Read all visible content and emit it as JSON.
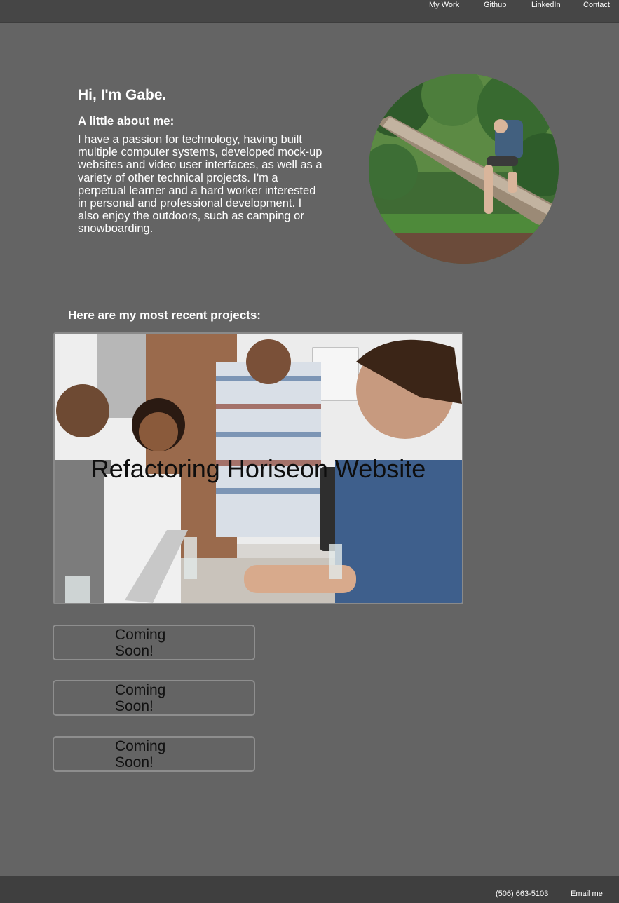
{
  "nav": {
    "items": [
      "My Work",
      "Github",
      "LinkedIn",
      "Contact"
    ]
  },
  "about": {
    "greeting": "Hi, I'm Gabe.",
    "heading": "A little about me:",
    "text": "I have a passion for technology, having built multiple computer systems, developed mock-up websites and video user interfaces, as well as a variety of other technical projects. I'm a perpetual learner and a hard worker interested in personal and professional development. I also enjoy the outdoors, such as camping or snowboarding.",
    "photo_icon": "profile-photo"
  },
  "projects": {
    "heading": "Here are my most recent projects:",
    "featured": {
      "title": "Refactoring Horiseon Website"
    },
    "placeholders": [
      "Coming Soon!",
      "Coming Soon!",
      "Coming Soon!"
    ]
  },
  "footer": {
    "phone": "(506) 663-5103",
    "email_label": "Email me"
  },
  "colors": {
    "background": "#646464",
    "header": "#464646",
    "footer": "#3f3f3f",
    "text": "#ffffff"
  }
}
